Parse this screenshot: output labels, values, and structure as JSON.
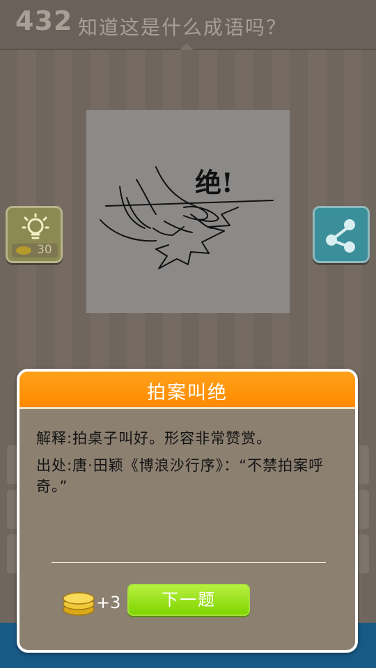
{
  "header": {
    "level": "432",
    "question": "知道这是什么成语吗？"
  },
  "puzzle": {
    "image_text": "绝!"
  },
  "hint": {
    "cost": "30"
  },
  "dialog": {
    "title": "拍案叫绝",
    "explanation": "解释:拍桌子叫好。形容非常赞赏。",
    "source": "出处:唐·田颖《博浪沙行序》：“不禁拍案呼奇。”",
    "reward": "+3",
    "next_label": "下一题"
  },
  "colors": {
    "header_orange": "#ff8a00",
    "next_green": "#8ad80a",
    "share_teal": "#3b8f9a",
    "hint_olive": "#8a8a52"
  }
}
